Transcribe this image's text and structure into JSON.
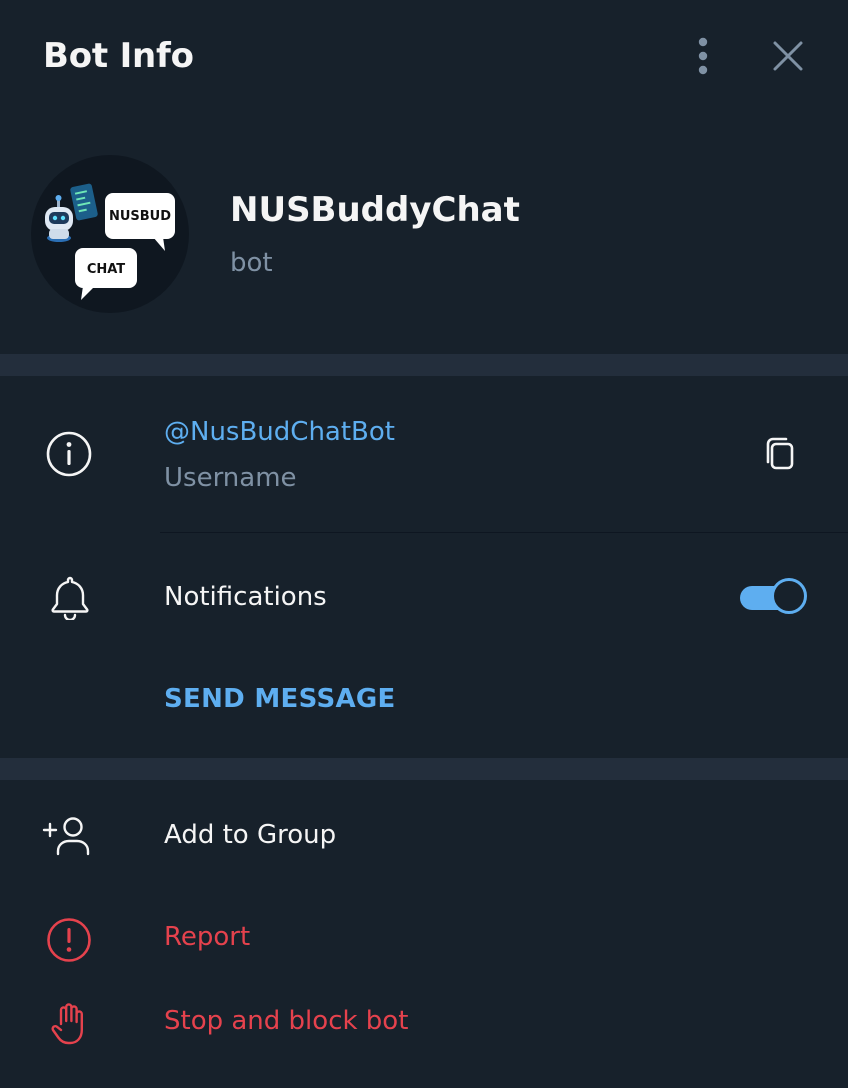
{
  "header": {
    "title": "Bot Info",
    "more_icon": "vertical-dots-icon",
    "close_icon": "close-icon"
  },
  "profile": {
    "name": "NUSBuddyChat",
    "status": "bot",
    "avatar": {
      "bubble_top_text": "NUSBUD",
      "bubble_bottom_text": "CHAT"
    }
  },
  "info": {
    "username_value": "@NusBudChatBot",
    "username_label": "Username",
    "info_icon": "info-circle-icon",
    "copy_icon": "copy-icon"
  },
  "notifications": {
    "label": "Notifications",
    "enabled": true,
    "icon": "bell-icon"
  },
  "send_message_label": "SEND MESSAGE",
  "actions": [
    {
      "label": "Add to Group",
      "icon": "add-user-icon",
      "color": "#f5f5f5"
    },
    {
      "label": "Report",
      "icon": "report-icon",
      "color": "#e5424d"
    },
    {
      "label": "Stop and block bot",
      "icon": "hand-stop-icon",
      "color": "#e5424d"
    }
  ],
  "colors": {
    "background": "#17212b",
    "divider": "#232e3c",
    "accent": "#5eaef0",
    "danger": "#e5424d",
    "secondary_text": "#7f91a4"
  }
}
